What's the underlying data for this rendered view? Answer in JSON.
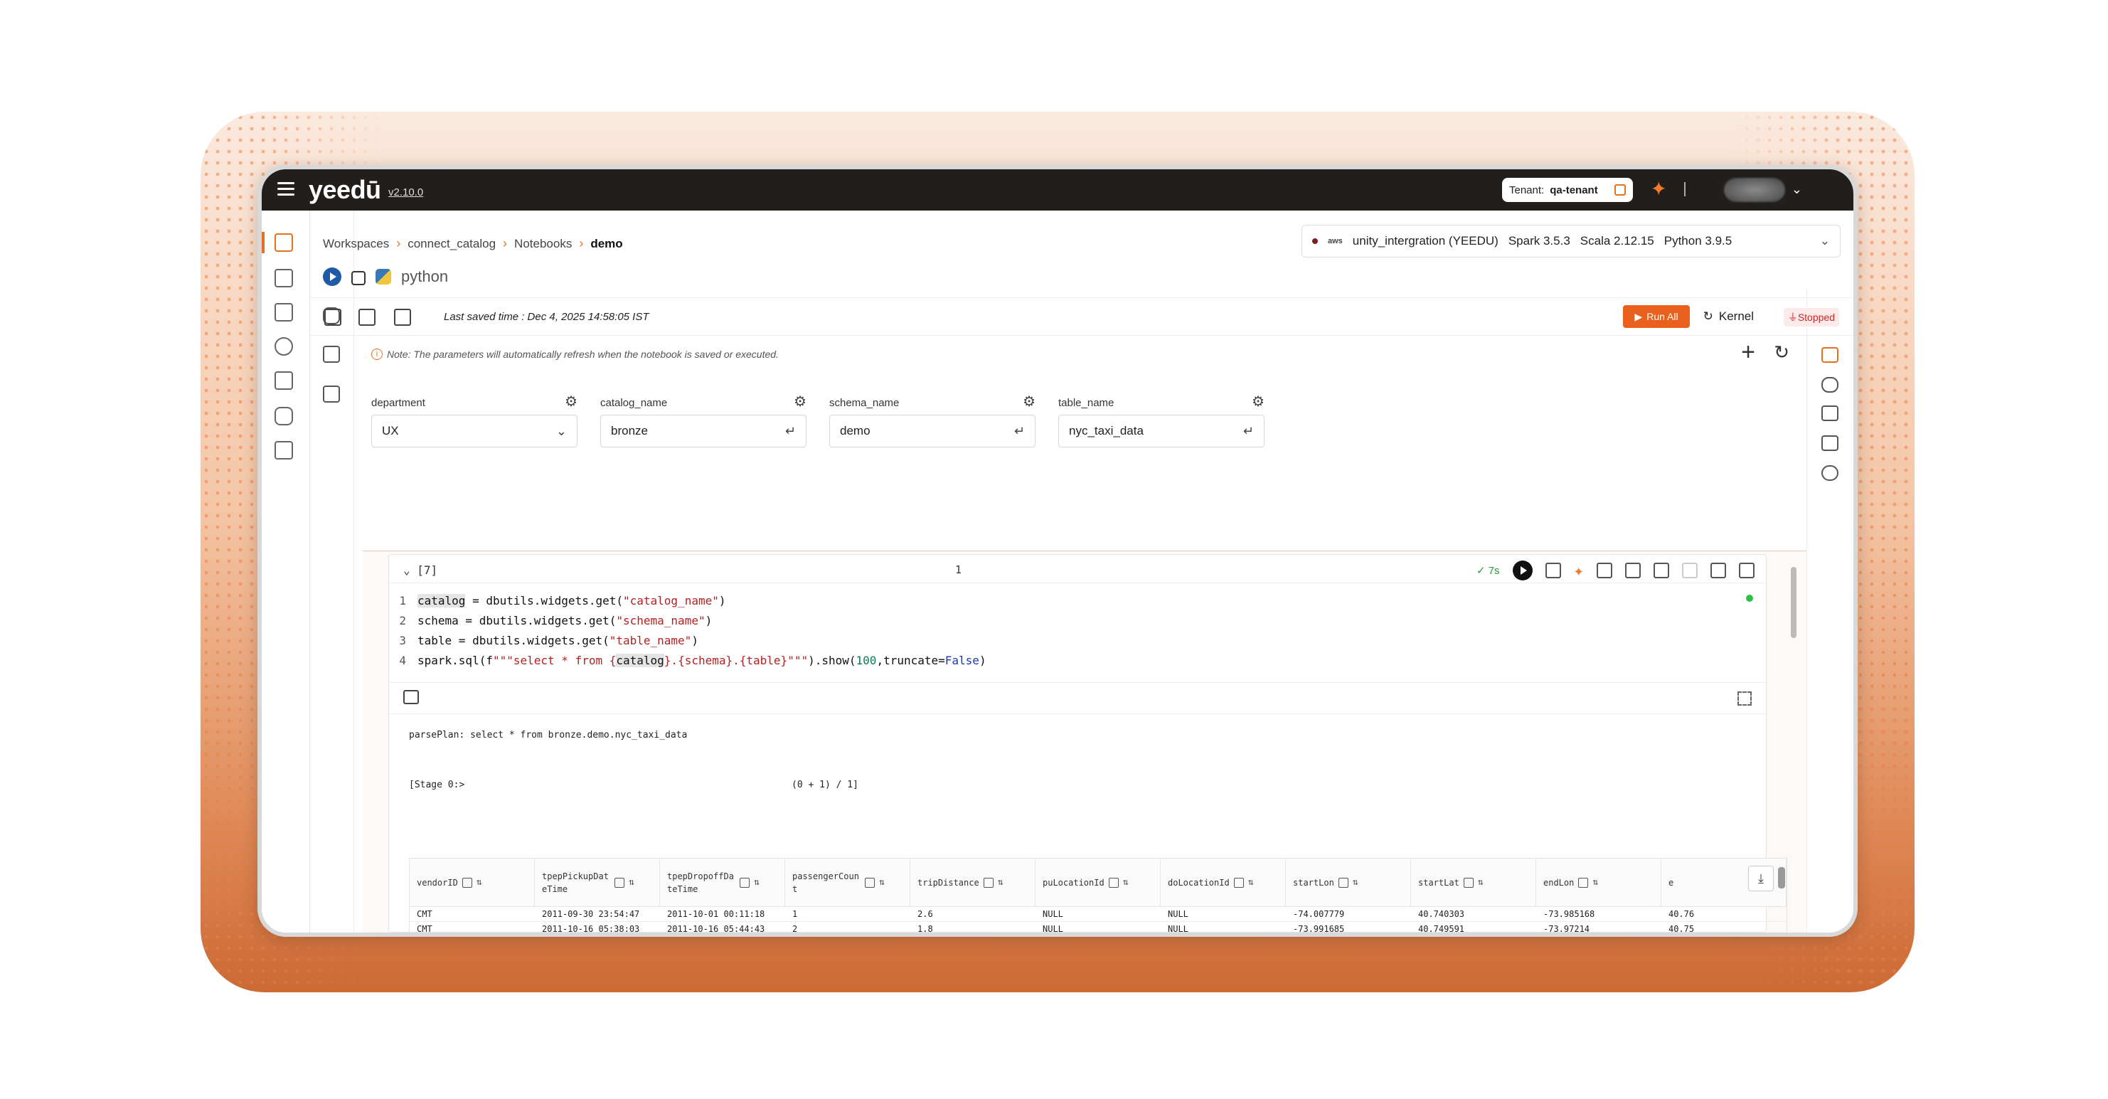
{
  "app": {
    "logo": "yeedū",
    "version": "v2.10.0"
  },
  "topbar": {
    "tenant_label": "Tenant:",
    "tenant_name": "qa-tenant"
  },
  "breadcrumb": [
    "Workspaces",
    "connect_catalog",
    "Notebooks",
    "demo"
  ],
  "cluster": {
    "provider": "aws",
    "name": "unity_intergration (YEEDU)",
    "spark": "Spark 3.5.3",
    "scala": "Scala 2.12.15",
    "python": "Python 3.9.5"
  },
  "language": "python",
  "toolbar": {
    "saved_time": "Last saved time : Dec 4, 2025 14:58:05 IST",
    "run_all": "Run All",
    "kernel": "Kernel",
    "kernel_status": "Stopped"
  },
  "note": "Note: The parameters will automatically refresh when the notebook is saved or executed.",
  "widgets": [
    {
      "label": "department",
      "value": "UX"
    },
    {
      "label": "catalog_name",
      "value": "bronze"
    },
    {
      "label": "schema_name",
      "value": "demo"
    },
    {
      "label": "table_name",
      "value": "nyc_taxi_data"
    }
  ],
  "cell": {
    "exec_count": "[7]",
    "number": "1",
    "duration": "7s",
    "code": [
      {
        "n": "1",
        "parts": [
          [
            "hl",
            "catalog"
          ],
          [
            "",
            " = dbutils.widgets.get("
          ],
          [
            "str",
            "\"catalog_name\""
          ],
          [
            "",
            ")"
          ]
        ]
      },
      {
        "n": "2",
        "parts": [
          [
            "",
            "schema = dbutils.widgets.get("
          ],
          [
            "str",
            "\"schema_name\""
          ],
          [
            "",
            ")"
          ]
        ]
      },
      {
        "n": "3",
        "parts": [
          [
            "",
            "table = dbutils.widgets.get("
          ],
          [
            "str",
            "\"table_name\""
          ],
          [
            "",
            ")"
          ]
        ]
      },
      {
        "n": "4",
        "parts": [
          [
            "",
            "spark.sql(f"
          ],
          [
            "str",
            "\"\"\"select * from {"
          ],
          [
            "hl",
            "catalog"
          ],
          [
            "str",
            "}.{schema}.{table}\"\"\""
          ],
          [
            "",
            ").show("
          ],
          [
            "num",
            "100"
          ],
          [
            "",
            ",truncate="
          ],
          [
            "kw",
            "False"
          ],
          [
            "",
            ")"
          ]
        ]
      }
    ],
    "output": {
      "plan": "parsePlan: select * from bronze.demo.nyc_taxi_data",
      "stage": "[Stage 0:>",
      "progress": "(0 + 1) / 1]"
    },
    "table": {
      "columns": [
        "vendorID",
        "tpepPickupDat eTime",
        "tpepDropoffDa teTime",
        "passengerCoun t",
        "tripDistance",
        "puLocationId",
        "doLocationId",
        "startLon",
        "startLat",
        "endLon",
        "e"
      ],
      "rows": [
        [
          "CMT",
          "2011-09-30 23:54:47",
          "2011-10-01 00:11:18",
          "1",
          "2.6",
          "NULL",
          "NULL",
          "-74.007779",
          "40.740303",
          "-73.985168",
          "40.76"
        ],
        [
          "CMT",
          "2011-10-16 05:38:03",
          "2011-10-16 05:44:43",
          "2",
          "1.8",
          "NULL",
          "NULL",
          "-73.991685",
          "40.749591",
          "-73.97214",
          "40.75"
        ]
      ]
    }
  }
}
